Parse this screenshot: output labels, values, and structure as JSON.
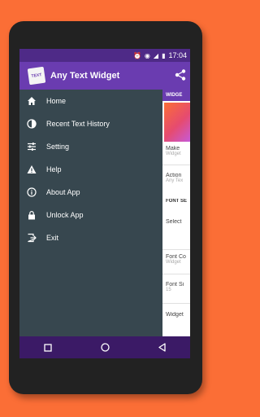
{
  "status_bar": {
    "time": "17:04",
    "icons": [
      "alarm-icon",
      "data-saver-icon",
      "signal-icon",
      "battery-icon"
    ]
  },
  "app_bar": {
    "logo_text": "TEXT",
    "title": "Any Text Widget",
    "share_icon": "share-icon"
  },
  "drawer": {
    "items": [
      {
        "label": "Home",
        "icon": "home-icon"
      },
      {
        "label": "Recent Text History",
        "icon": "history-icon"
      },
      {
        "label": "Setting",
        "icon": "settings-sliders-icon"
      },
      {
        "label": "Help",
        "icon": "warning-icon"
      },
      {
        "label": "About App",
        "icon": "info-icon"
      },
      {
        "label": "Unlock App",
        "icon": "lock-icon"
      },
      {
        "label": "Exit",
        "icon": "exit-icon"
      }
    ]
  },
  "background": {
    "tab_label": "WIDGE",
    "rows": [
      {
        "title": "Make",
        "sub": "Widget"
      },
      {
        "title": "Action",
        "sub": "Any Tex"
      },
      {
        "title": "FONT SE",
        "sub": ""
      },
      {
        "title": "Select",
        "sub": ""
      },
      {
        "title": "Font Co",
        "sub": "Widget"
      },
      {
        "title": "Font Si",
        "sub": "15"
      },
      {
        "title": "Widget",
        "sub": ""
      }
    ]
  },
  "colors": {
    "background": "#fb6e36",
    "status_bar": "#4e2a87",
    "app_bar": "#6a3cb0",
    "drawer": "#37474f",
    "nav_bar": "#3b1a66"
  }
}
